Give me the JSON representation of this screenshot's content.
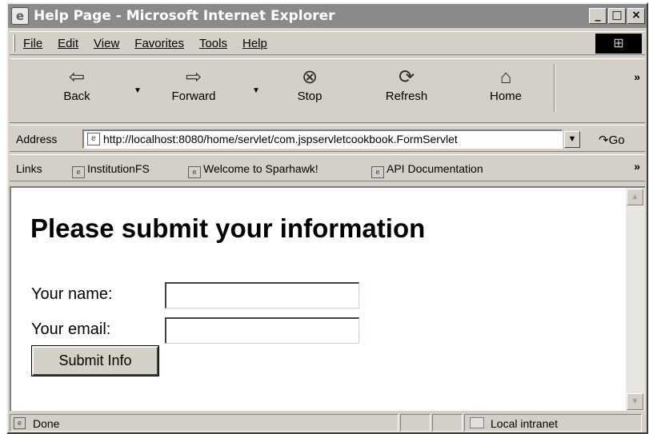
{
  "window": {
    "title": "Help Page - Microsoft Internet Explorer",
    "minimize": "_",
    "maximize": "□",
    "close": "×"
  },
  "menu": {
    "items": [
      "File",
      "Edit",
      "View",
      "Favorites",
      "Tools",
      "Help"
    ]
  },
  "toolbar": {
    "back": "Back",
    "forward": "Forward",
    "stop": "Stop",
    "refresh": "Refresh",
    "home": "Home",
    "more": "»"
  },
  "address_bar": {
    "label": "Address",
    "url": "http://localhost:8080/home/servlet/com.jspservletcookbook.FormServlet",
    "go": "Go"
  },
  "links_bar": {
    "label": "Links",
    "links": [
      "InstitutionFS",
      "Welcome to Sparhawk!",
      "API Documentation"
    ],
    "more": "»"
  },
  "page": {
    "heading": "Please submit your information",
    "name_label": "Your name:",
    "name_value": "",
    "email_label": "Your email:",
    "email_value": "",
    "submit": "Submit Info"
  },
  "status_bar": {
    "text": "Done",
    "zone": "Local intranet"
  },
  "icons": {
    "window": "ie-page-icon",
    "back": "back-arrow-icon",
    "forward": "forward-arrow-icon",
    "stop": "stop-icon",
    "refresh": "refresh-icon",
    "home": "home-icon",
    "go": "go-arrow-icon"
  }
}
